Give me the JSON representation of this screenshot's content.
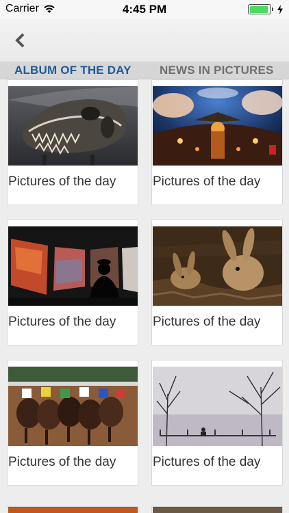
{
  "status_bar": {
    "carrier": "Carrier",
    "time": "4:45 PM",
    "battery_level": 0.9,
    "wifi_icon": "wifi-icon",
    "charging_icon": "bolt-icon"
  },
  "nav": {
    "back_icon": "chevron-left-icon"
  },
  "tabs": [
    {
      "label": "ALBUM OF THE DAY",
      "active": true
    },
    {
      "label": "NEWS IN PICTURES",
      "active": false
    }
  ],
  "albums": [
    {
      "caption": "Pictures of the day",
      "image": "dinosaur-skull"
    },
    {
      "caption": "Pictures of the day",
      "image": "dome-ceremony"
    },
    {
      "caption": "Pictures of the day",
      "image": "officer-silhouette"
    },
    {
      "caption": "Pictures of the day",
      "image": "rabbits"
    },
    {
      "caption": "Pictures of the day",
      "image": "horse-race"
    },
    {
      "caption": "Pictures of the day",
      "image": "winter-park"
    }
  ],
  "colors": {
    "tab_active": "#1e5a97",
    "tab_inactive": "#6f6f6f",
    "battery": "#4cd964"
  }
}
